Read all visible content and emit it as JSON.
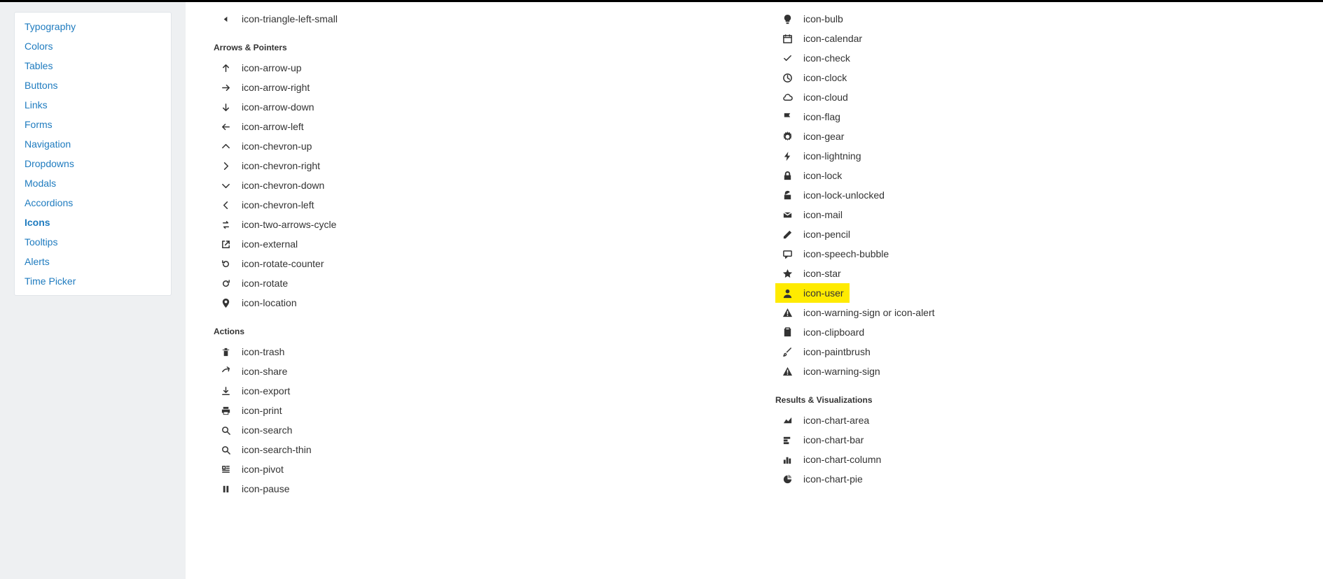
{
  "sidebar": {
    "items": [
      {
        "label": "Typography",
        "active": false
      },
      {
        "label": "Colors",
        "active": false
      },
      {
        "label": "Tables",
        "active": false
      },
      {
        "label": "Buttons",
        "active": false
      },
      {
        "label": "Links",
        "active": false
      },
      {
        "label": "Forms",
        "active": false
      },
      {
        "label": "Navigation",
        "active": false
      },
      {
        "label": "Dropdowns",
        "active": false
      },
      {
        "label": "Modals",
        "active": false
      },
      {
        "label": "Accordions",
        "active": false
      },
      {
        "label": "Icons",
        "active": true
      },
      {
        "label": "Tooltips",
        "active": false
      },
      {
        "label": "Alerts",
        "active": false
      },
      {
        "label": "Time Picker",
        "active": false
      }
    ]
  },
  "left_column": {
    "leading_items": [
      {
        "icon": "triangle-left-small",
        "label": "icon-triangle-left-small"
      }
    ],
    "groups": [
      {
        "title": "Arrows & Pointers",
        "items": [
          {
            "icon": "arrow-up",
            "label": "icon-arrow-up"
          },
          {
            "icon": "arrow-right",
            "label": "icon-arrow-right"
          },
          {
            "icon": "arrow-down",
            "label": "icon-arrow-down"
          },
          {
            "icon": "arrow-left",
            "label": "icon-arrow-left"
          },
          {
            "icon": "chevron-up",
            "label": "icon-chevron-up"
          },
          {
            "icon": "chevron-right",
            "label": "icon-chevron-right"
          },
          {
            "icon": "chevron-down",
            "label": "icon-chevron-down"
          },
          {
            "icon": "chevron-left",
            "label": "icon-chevron-left"
          },
          {
            "icon": "two-arrows-cycle",
            "label": "icon-two-arrows-cycle"
          },
          {
            "icon": "external",
            "label": "icon-external"
          },
          {
            "icon": "rotate-counter",
            "label": "icon-rotate-counter"
          },
          {
            "icon": "rotate",
            "label": "icon-rotate"
          },
          {
            "icon": "location",
            "label": "icon-location"
          }
        ]
      },
      {
        "title": "Actions",
        "items": [
          {
            "icon": "trash",
            "label": "icon-trash"
          },
          {
            "icon": "share",
            "label": "icon-share"
          },
          {
            "icon": "export",
            "label": "icon-export"
          },
          {
            "icon": "print",
            "label": "icon-print"
          },
          {
            "icon": "search",
            "label": "icon-search"
          },
          {
            "icon": "search-thin",
            "label": "icon-search-thin"
          },
          {
            "icon": "pivot",
            "label": "icon-pivot"
          },
          {
            "icon": "pause",
            "label": "icon-pause"
          }
        ]
      }
    ]
  },
  "right_column": {
    "leading_items": [
      {
        "icon": "bulb",
        "label": "icon-bulb"
      },
      {
        "icon": "calendar",
        "label": "icon-calendar"
      },
      {
        "icon": "check",
        "label": "icon-check"
      },
      {
        "icon": "clock",
        "label": "icon-clock"
      },
      {
        "icon": "cloud",
        "label": "icon-cloud"
      },
      {
        "icon": "flag",
        "label": "icon-flag"
      },
      {
        "icon": "gear",
        "label": "icon-gear"
      },
      {
        "icon": "lightning",
        "label": "icon-lightning"
      },
      {
        "icon": "lock",
        "label": "icon-lock"
      },
      {
        "icon": "lock-unlocked",
        "label": "icon-lock-unlocked"
      },
      {
        "icon": "mail",
        "label": "icon-mail"
      },
      {
        "icon": "pencil",
        "label": "icon-pencil"
      },
      {
        "icon": "speech-bubble",
        "label": "icon-speech-bubble"
      },
      {
        "icon": "star",
        "label": "icon-star"
      },
      {
        "icon": "user",
        "label": "icon-user",
        "highlight": true
      },
      {
        "icon": "warning-sign",
        "label": "icon-warning-sign or icon-alert"
      },
      {
        "icon": "clipboard",
        "label": "icon-clipboard"
      },
      {
        "icon": "paintbrush",
        "label": "icon-paintbrush"
      },
      {
        "icon": "warning-sign",
        "label": "icon-warning-sign"
      }
    ],
    "groups": [
      {
        "title": "Results & Visualizations",
        "items": [
          {
            "icon": "chart-area",
            "label": "icon-chart-area"
          },
          {
            "icon": "chart-bar",
            "label": "icon-chart-bar"
          },
          {
            "icon": "chart-column",
            "label": "icon-chart-column"
          },
          {
            "icon": "chart-pie",
            "label": "icon-chart-pie"
          }
        ]
      }
    ]
  }
}
